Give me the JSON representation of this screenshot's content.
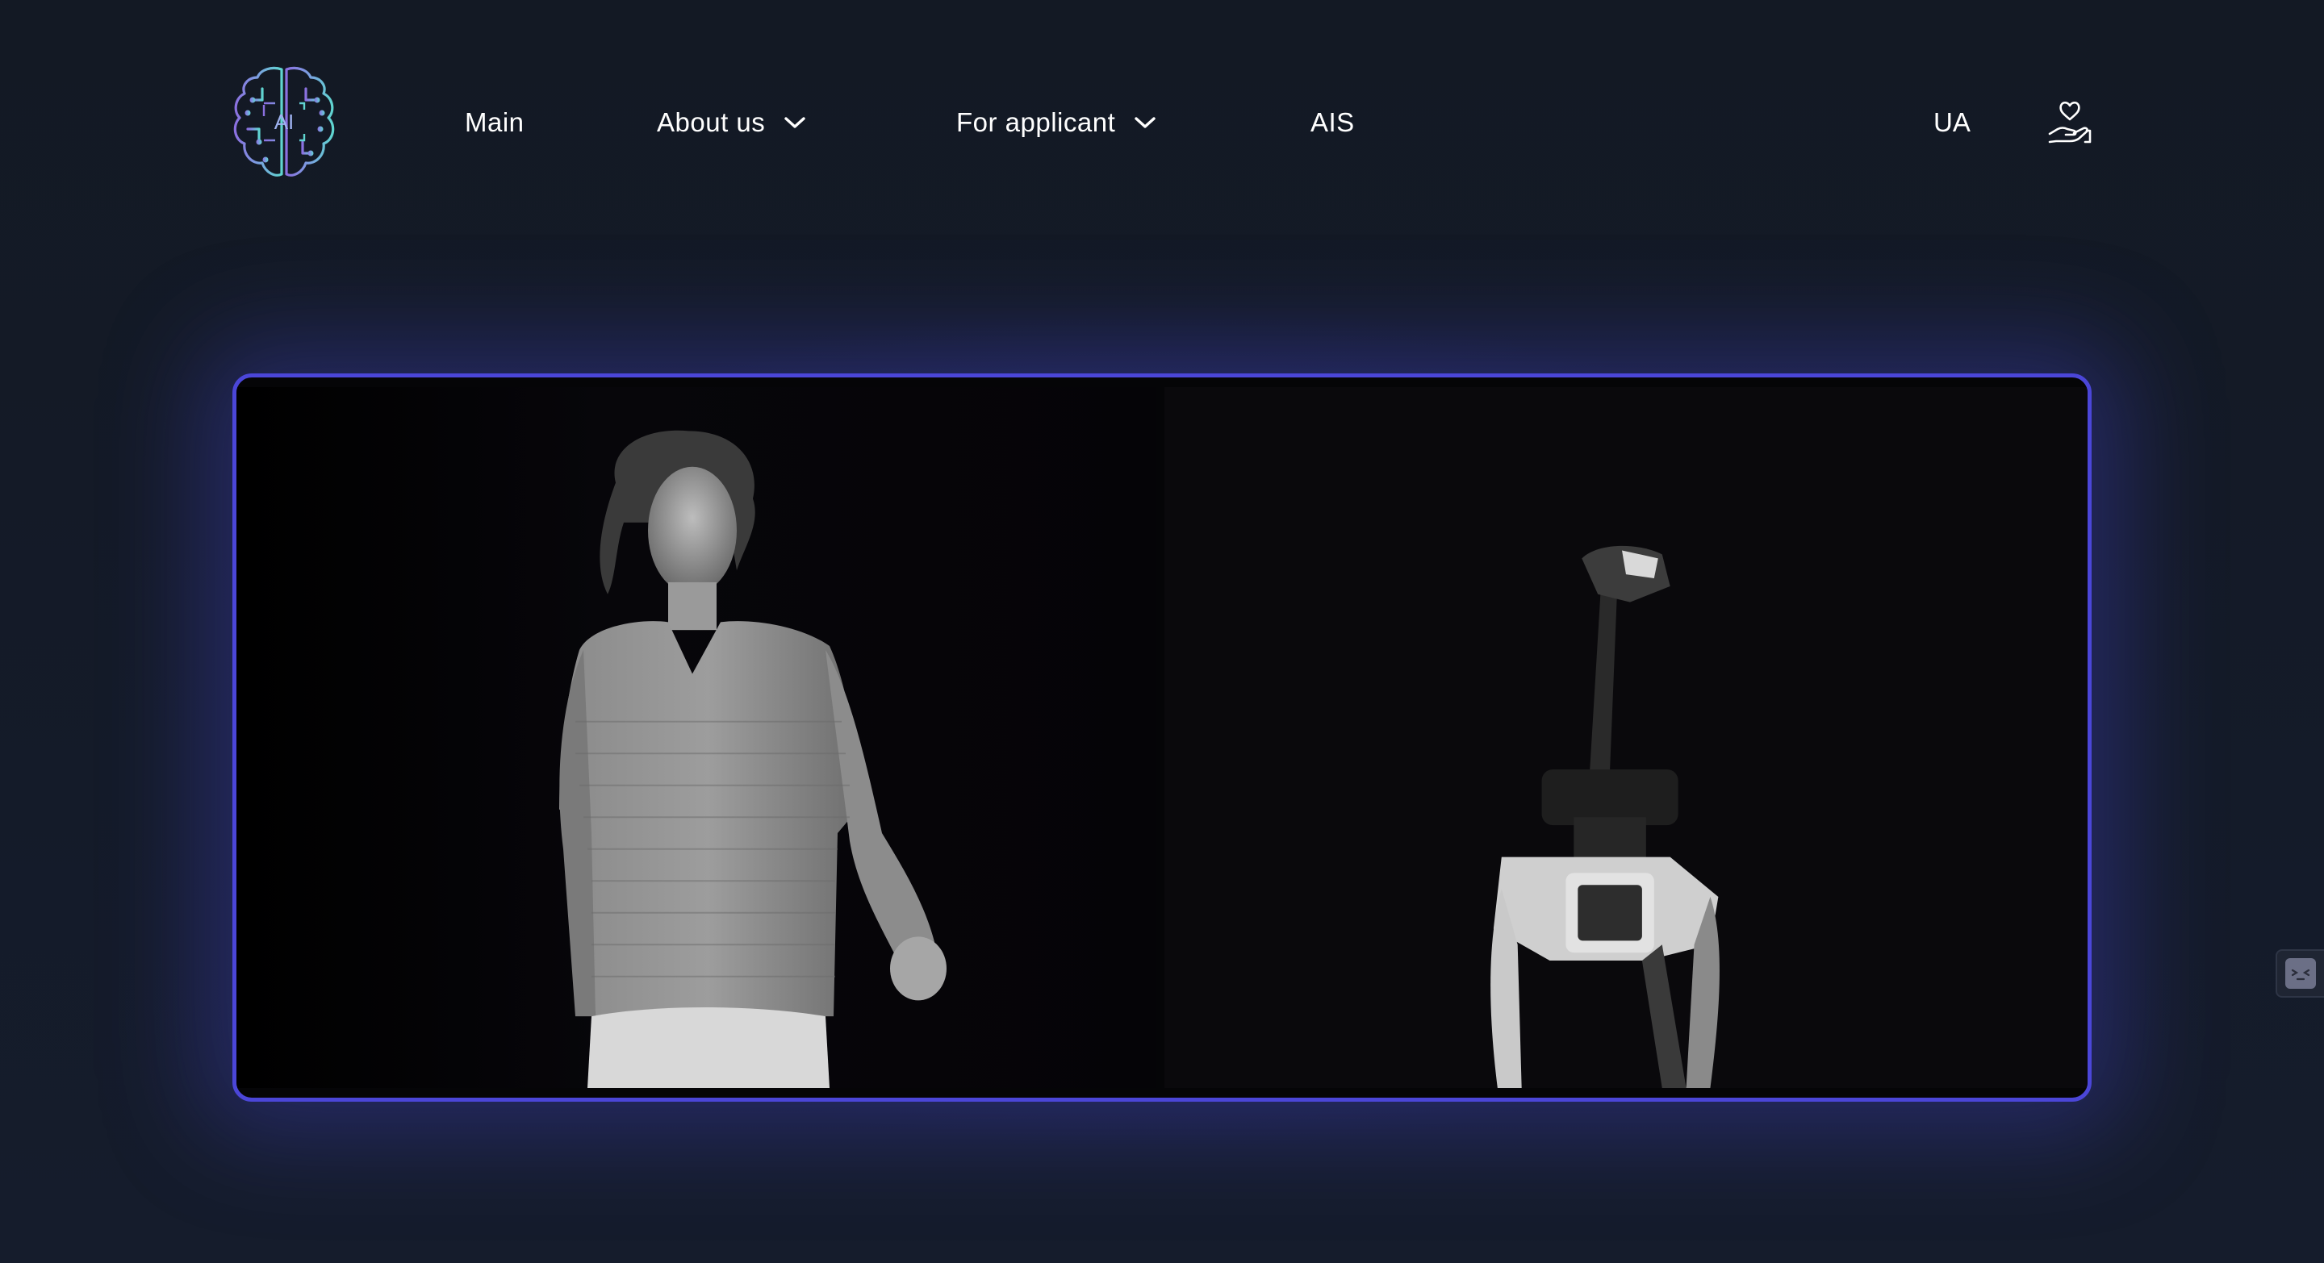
{
  "header": {
    "logo_icon": "brain-ai-logo",
    "logo_text": "AI",
    "nav": {
      "main": "Main",
      "about": "About us",
      "applicant": "For applicant",
      "ais": "AIS"
    },
    "language": "UA",
    "donate_icon": "heart-hand-icon"
  },
  "video": {
    "accent_color": "#4b46d8"
  },
  "colors": {
    "background": "#141a27",
    "accent": "#4b46d8",
    "logo_left": "#8b6fe0",
    "logo_right": "#5fd6d0"
  }
}
